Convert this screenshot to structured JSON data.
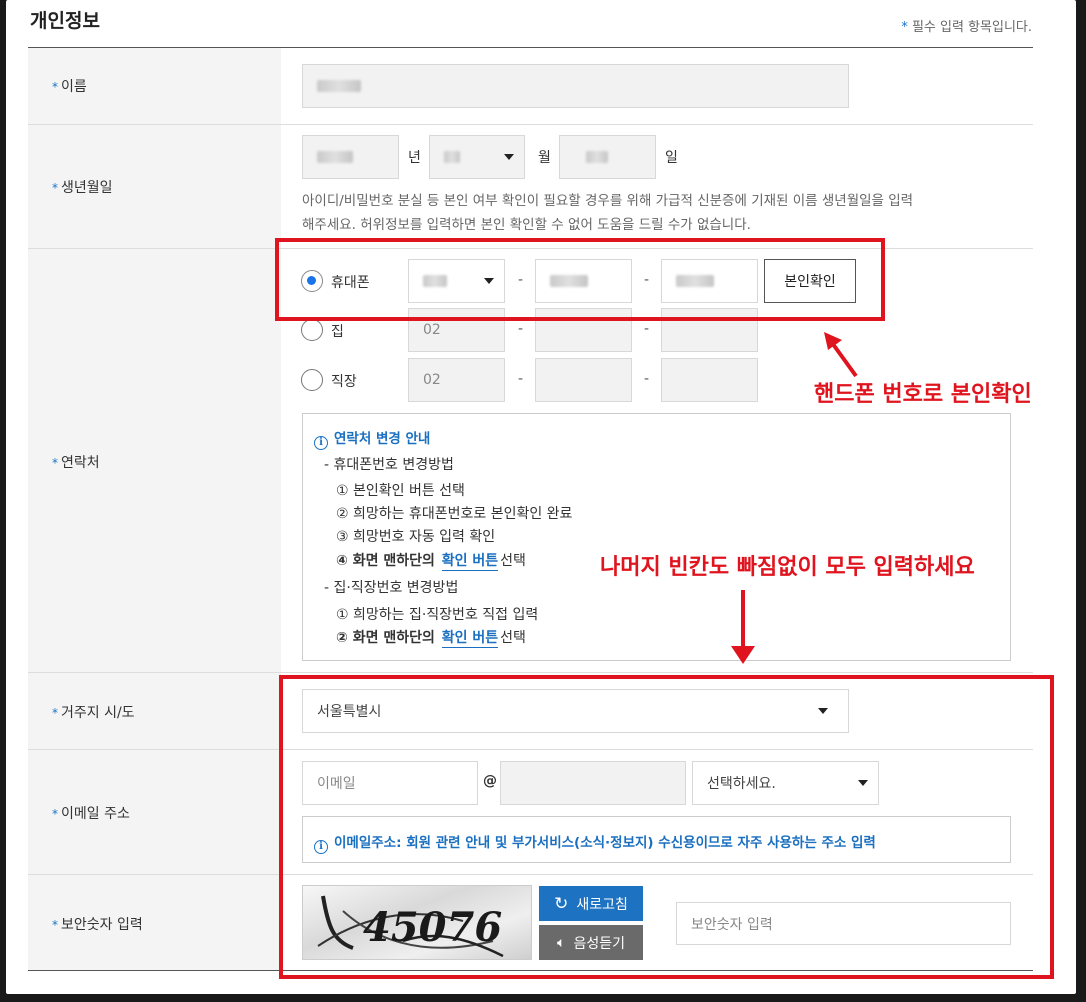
{
  "section_title": "개인정보",
  "required_note": {
    "star": "*",
    "text": "필수 입력 항목입니다."
  },
  "rows": {
    "name": {
      "label": "이름"
    },
    "birth": {
      "label": "생년월일",
      "unit_year": "년",
      "unit_month": "월",
      "unit_day": "일",
      "help_line1": "아이디/비밀번호 분실 등 본인 여부 확인이 필요할 경우를 위해 가급적 신분증에 기재된 이름 생년월일을 입력",
      "help_line2": "해주세요. 허위정보를 입력하면 본인 확인할 수 없어 도움을 드릴 수가 없습니다."
    },
    "contact": {
      "label": "연락처",
      "mobile_label": "휴대폰",
      "home_label": "집",
      "work_label": "직장",
      "home_prefix": "02",
      "work_prefix": "02",
      "dash": "-",
      "verify_button": "본인확인",
      "info": {
        "title": "연락처 변경 안내",
        "mobile_heading": "- 휴대폰번호 변경방법",
        "mobile_step1": "① 본인확인 버튼 선택",
        "mobile_step2": "② 희망하는 휴대폰번호로 본인확인 완료",
        "mobile_step3": "③ 희망번호 자동 입력 확인",
        "mobile_step4_pre": "④ 화면 맨하단의",
        "mobile_step4_link": "확인 버튼",
        "mobile_step4_post": "선택",
        "home_heading": "- 집·직장번호 변경방법",
        "home_step1": "① 희망하는 집·직장번호 직접 입력",
        "home_step2_pre": "② 화면 맨하단의",
        "home_step2_link": "확인 버튼",
        "home_step2_post": "선택"
      }
    },
    "region": {
      "label": "거주지 시/도",
      "selected": "서울특별시"
    },
    "email": {
      "label": "이메일 주소",
      "id_placeholder": "이메일",
      "at": "@",
      "domain_select": "선택하세요.",
      "info": "이메일주소: 회원 관련 안내 및 부가서비스(소식·정보지) 수신용이므로 자주 사용하는 주소 입력"
    },
    "captcha": {
      "label": "보안숫자 입력",
      "captcha_text": "45076",
      "refresh_button": "새로고침",
      "audio_button": "음성듣기",
      "input_placeholder": "보안숫자 입력"
    }
  },
  "annotations": {
    "phone_verify": "핸드폰 번호로 본인확인",
    "fill_all": "나머지 빈칸도 빠짐없이 모두 입력하세요"
  },
  "colors": {
    "accent_blue": "#1a73c8",
    "annotation_red": "#e0141e",
    "label_bg": "#f4f4f4"
  }
}
